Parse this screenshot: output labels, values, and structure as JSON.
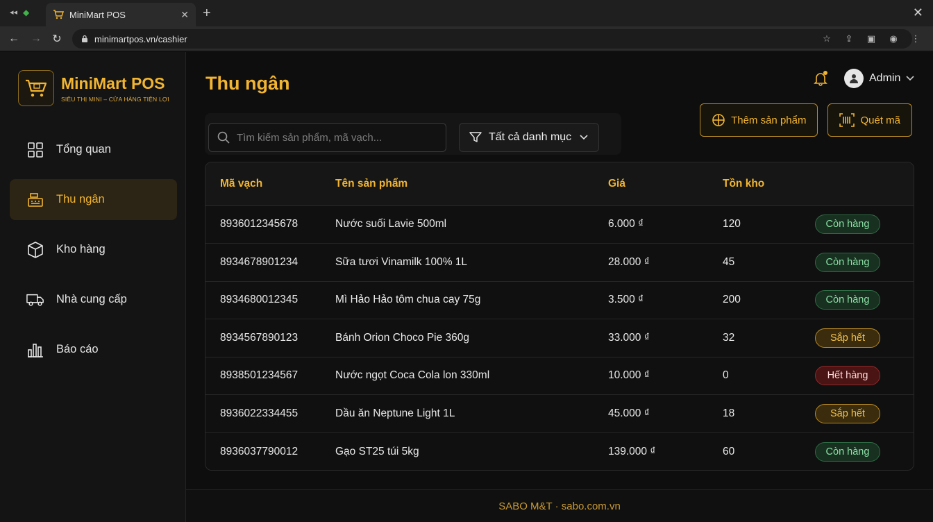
{
  "browser": {
    "tab_title": "MiniMart POS",
    "url": "minimartpos.vn/cashier"
  },
  "brand": {
    "name": "MiniMart POS",
    "tagline": "SIÊU THỊ MINI – CỬA HÀNG TIỆN LỢI"
  },
  "sidebar": {
    "items": [
      {
        "label": "Tổng quan",
        "icon": "grid-icon",
        "active": false
      },
      {
        "label": "Thu ngân",
        "icon": "cash-register-icon",
        "active": true
      },
      {
        "label": "Kho hàng",
        "icon": "box-icon",
        "active": false
      },
      {
        "label": "Nhà cung cấp",
        "icon": "truck-icon",
        "active": false
      },
      {
        "label": "Báo cáo",
        "icon": "bar-chart-icon",
        "active": false
      }
    ]
  },
  "header": {
    "title": "Thu ngân",
    "user_name": "Admin"
  },
  "actions": {
    "add_product": "Thêm sản phẩm",
    "scan_code": "Quét mã"
  },
  "filters": {
    "search_placeholder": "Tìm kiếm sản phẩm, mã vạch...",
    "category_selected": "Tất cả danh mục"
  },
  "table": {
    "columns": [
      "Mã vạch",
      "Tên sản phẩm",
      "Giá",
      "Tồn kho"
    ],
    "rows": [
      {
        "barcode": "8936012345678",
        "name": "Nước suối Lavie 500ml",
        "price": "6.000 ₫",
        "stock": "120",
        "status": "Còn hàng",
        "status_type": "ok"
      },
      {
        "barcode": "8934678901234",
        "name": "Sữa tươi Vinamilk 100% 1L",
        "price": "28.000 ₫",
        "stock": "45",
        "status": "Còn hàng",
        "status_type": "ok"
      },
      {
        "barcode": "8934680012345",
        "name": "Mì Hảo Hảo tôm chua cay 75g",
        "price": "3.500 ₫",
        "stock": "200",
        "status": "Còn hàng",
        "status_type": "ok"
      },
      {
        "barcode": "8934567890123",
        "name": "Bánh Orion Choco Pie 360g",
        "price": "33.000 ₫",
        "stock": "32",
        "status": "Sắp hết",
        "status_type": "low"
      },
      {
        "barcode": "8938501234567",
        "name": "Nước ngọt Coca Cola lon 330ml",
        "price": "10.000 ₫",
        "stock": "0",
        "status": "Hết hàng",
        "status_type": "out"
      },
      {
        "barcode": "8936022334455",
        "name": "Dầu ăn Neptune Light 1L",
        "price": "45.000 ₫",
        "stock": "18",
        "status": "Sắp hết",
        "status_type": "low"
      },
      {
        "barcode": "8936037790012",
        "name": "Gạo ST25 túi 5kg",
        "price": "139.000 ₫",
        "stock": "60",
        "status": "Còn hàng",
        "status_type": "ok"
      }
    ]
  },
  "footer": {
    "text": "SABO M&T · sabo.com.vn"
  },
  "colors": {
    "accent": "#f2b531",
    "in_stock": "#8de0a8",
    "low_stock": "#f2c14a",
    "out_of_stock": "#ffd8d8"
  }
}
